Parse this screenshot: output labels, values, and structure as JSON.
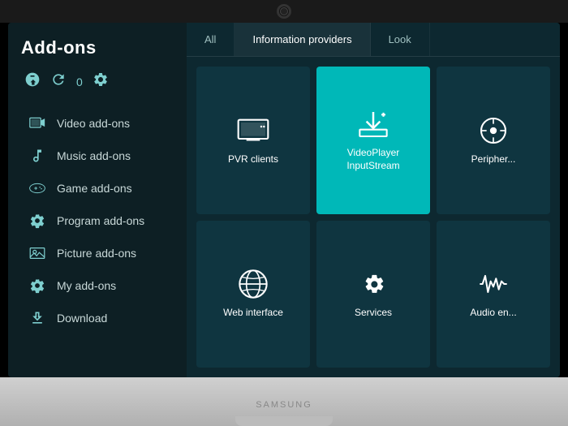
{
  "page": {
    "title": "Add-ons"
  },
  "camera": {
    "label": "Camera"
  },
  "monitor": {
    "brand": "SAMSUNG"
  },
  "sidebar": {
    "title": "Add-ons",
    "toolbar": {
      "install_label": "Install from repository",
      "count": "0",
      "settings_label": "Settings"
    },
    "items": [
      {
        "id": "video",
        "label": "Video add-ons",
        "icon": "video-icon"
      },
      {
        "id": "music",
        "label": "Music add-ons",
        "icon": "music-icon"
      },
      {
        "id": "game",
        "label": "Game add-ons",
        "icon": "game-icon"
      },
      {
        "id": "program",
        "label": "Program add-ons",
        "icon": "program-icon"
      },
      {
        "id": "picture",
        "label": "Picture add-ons",
        "icon": "picture-icon"
      },
      {
        "id": "my",
        "label": "My add-ons",
        "icon": "my-addons-icon"
      },
      {
        "id": "download",
        "label": "Download",
        "icon": "download-icon"
      }
    ]
  },
  "tabs": [
    {
      "id": "all",
      "label": "All",
      "active": false
    },
    {
      "id": "info-providers",
      "label": "Information providers",
      "active": true
    },
    {
      "id": "look",
      "label": "Look",
      "active": false
    }
  ],
  "grid": {
    "tiles": [
      {
        "id": "pvr",
        "label": "PVR clients",
        "icon": "pvr-icon",
        "active": false
      },
      {
        "id": "videoplayer",
        "label": "VideoPlayer InputStream",
        "icon": "videoplayer-icon",
        "active": true
      },
      {
        "id": "peripherals",
        "label": "Peripher...",
        "icon": "peripherals-icon",
        "active": false
      },
      {
        "id": "web-interface",
        "label": "Web interface",
        "icon": "web-icon",
        "active": false
      },
      {
        "id": "services",
        "label": "Services",
        "icon": "services-icon",
        "active": false
      },
      {
        "id": "audio-encoder",
        "label": "Audio en...",
        "icon": "audio-icon",
        "active": false
      }
    ]
  }
}
